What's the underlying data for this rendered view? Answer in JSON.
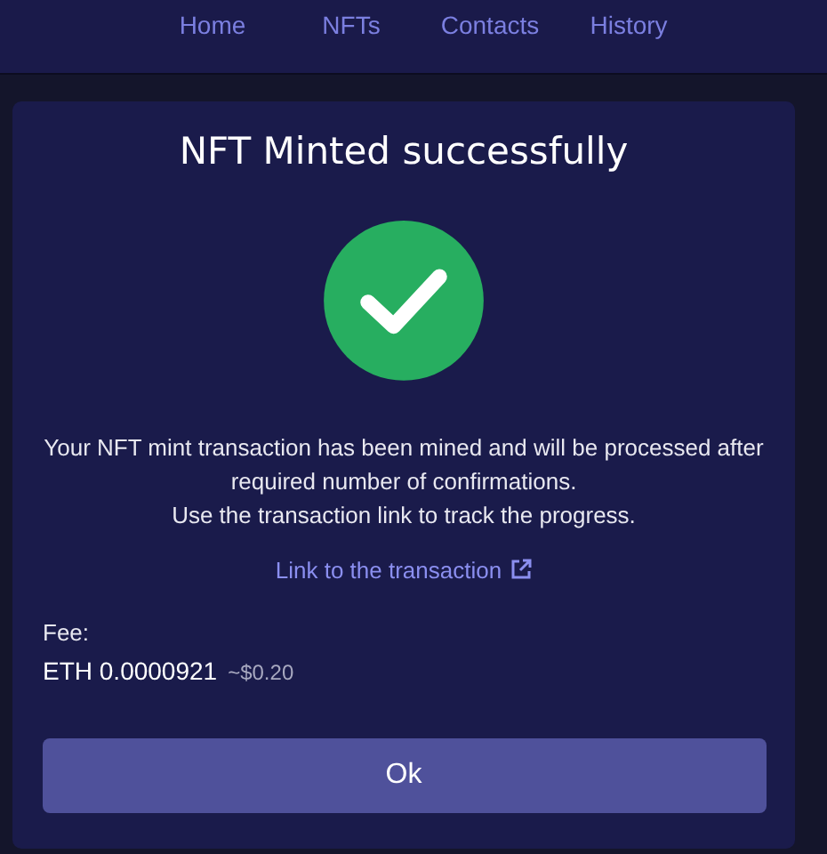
{
  "nav": {
    "items": [
      {
        "label": "Home"
      },
      {
        "label": "NFTs"
      },
      {
        "label": "Contacts"
      },
      {
        "label": "History"
      }
    ]
  },
  "dialog": {
    "title": "NFT Minted successfully",
    "message": [
      "Your NFT mint transaction has been mined and will be processed after required number of confirmations.",
      "Use the transaction link to track the progress."
    ],
    "link": "Link to the transaction",
    "fee_label": "Fee:",
    "fee_amount": "ETH 0.0000921",
    "fee_fiat": "~$0.20",
    "button": "Ok"
  }
}
